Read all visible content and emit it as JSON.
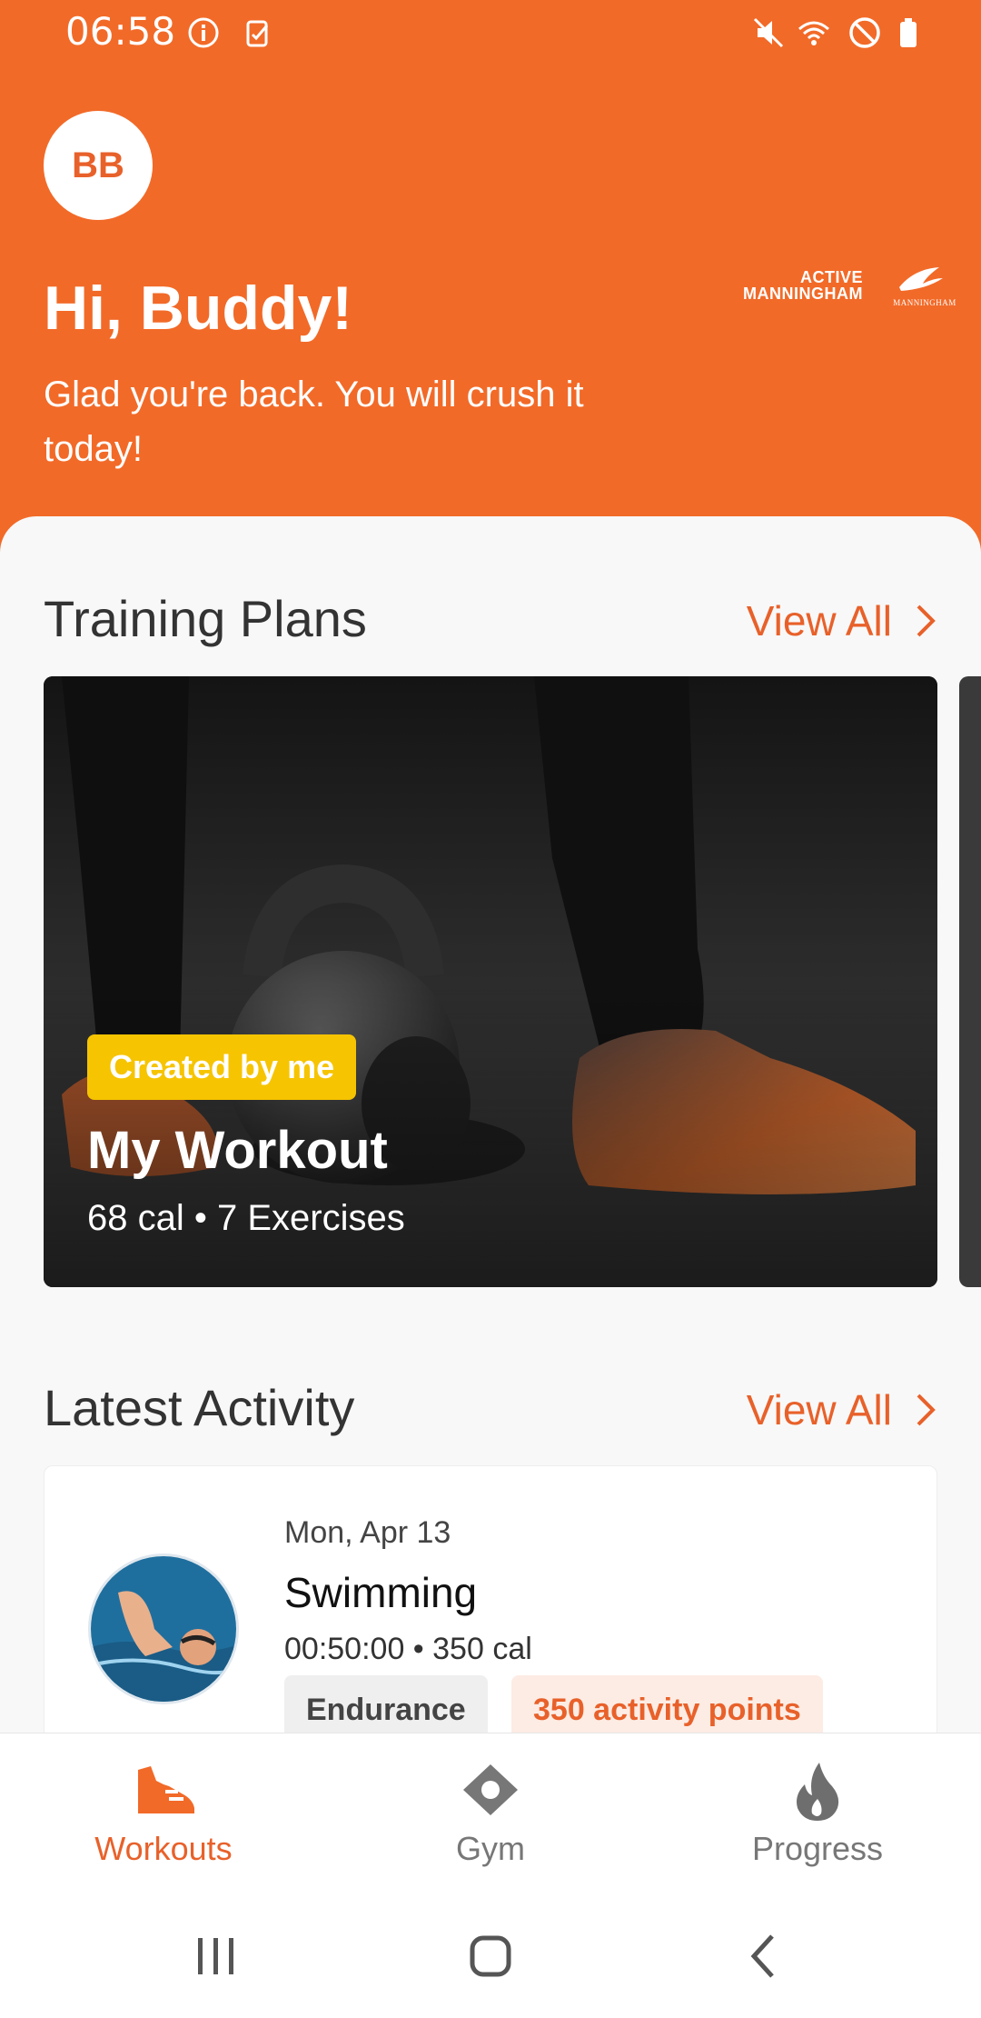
{
  "status_bar": {
    "time": "06:58"
  },
  "header": {
    "avatar_initials": "BB",
    "greeting": "Hi, Buddy!",
    "subtext": "Glad you're back. You will crush it today!",
    "brand_logo_text": "ACTIVE MANNINGHAM",
    "brand_logo_sub": "MANNINGHAM"
  },
  "training_plans": {
    "title": "Training Plans",
    "view_all": "View All",
    "cards": [
      {
        "badge": "Created by me",
        "title": "My Workout",
        "meta": "68 cal • 7 Exercises"
      }
    ]
  },
  "latest_activity": {
    "title": "Latest Activity",
    "view_all": "View All",
    "items": [
      {
        "date": "Mon, Apr 13",
        "name": "Swimming",
        "meta": "00:50:00 • 350 cal",
        "tags": [
          "Endurance",
          "350 activity points"
        ]
      }
    ]
  },
  "bottom_nav": {
    "items": [
      {
        "label": "Workouts",
        "icon": "shoe-icon",
        "active": true
      },
      {
        "label": "Gym",
        "icon": "location-pin-icon",
        "active": false
      },
      {
        "label": "Progress",
        "icon": "flame-icon",
        "active": false
      }
    ]
  },
  "colors": {
    "accent": "#f26a28",
    "badge_yellow": "#f6c400",
    "inactive": "#777777"
  }
}
